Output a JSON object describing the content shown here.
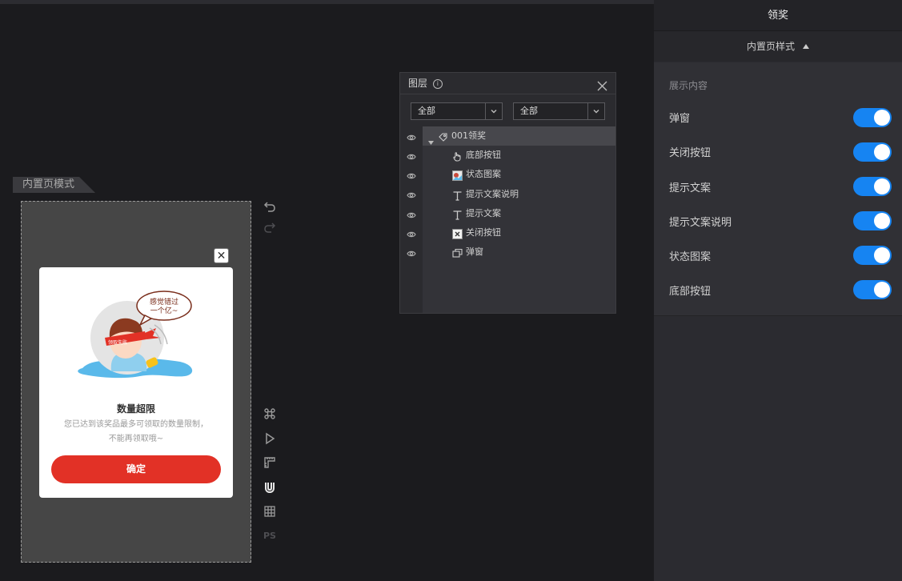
{
  "canvas": {
    "mode_label": "内置页模式",
    "dialog": {
      "bubble_text_1": "感觉错过",
      "bubble_text_2": "一个亿~",
      "headband_text": "领取失败",
      "title": "数量超限",
      "description": "您已达到该奖品最多可领取的数量限制，不能再领取哦~",
      "confirm_label": "确定"
    },
    "tools": {
      "ps_label": "PS"
    }
  },
  "layers_panel": {
    "title": "图层",
    "filter_1": "全部",
    "filter_2": "全部",
    "root": "001领奖",
    "items": [
      {
        "label": "底部按钮",
        "icon": "hand-pointer-icon"
      },
      {
        "label": "状态图案",
        "icon": "image-icon"
      },
      {
        "label": "提示文案说明",
        "icon": "text-icon"
      },
      {
        "label": "提示文案",
        "icon": "text-icon"
      },
      {
        "label": "关闭按钮",
        "icon": "close-box-icon"
      },
      {
        "label": "弹窗",
        "icon": "window-icon"
      }
    ]
  },
  "right_panel": {
    "title": "领奖",
    "section": "内置页样式",
    "subhead": "展示内容",
    "options": [
      {
        "label": "弹窗",
        "on": true
      },
      {
        "label": "关闭按钮",
        "on": true
      },
      {
        "label": "提示文案",
        "on": true
      },
      {
        "label": "提示文案说明",
        "on": true
      },
      {
        "label": "状态图案",
        "on": true
      },
      {
        "label": "底部按钮",
        "on": true
      }
    ]
  },
  "colors": {
    "accent_toggle": "#1684f2",
    "confirm_button": "#e23126"
  }
}
